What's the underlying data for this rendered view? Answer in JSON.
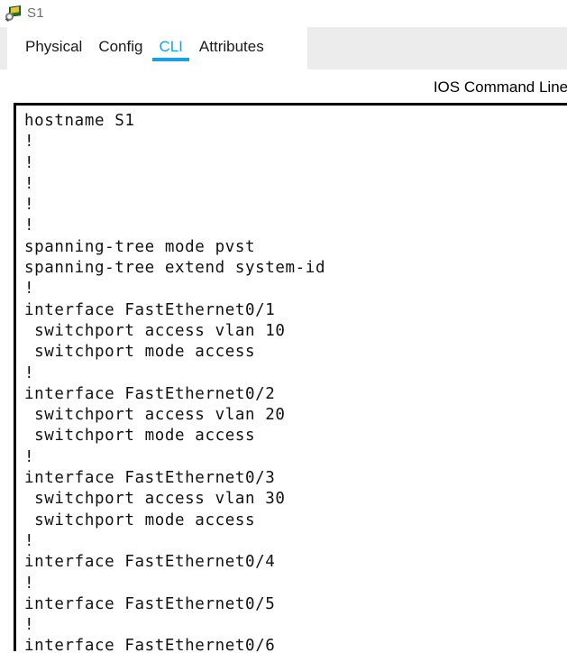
{
  "window": {
    "title": "S1",
    "icon": "switch-magnifier-icon"
  },
  "tabs": [
    {
      "label": "Physical",
      "active": false
    },
    {
      "label": "Config",
      "active": false
    },
    {
      "label": "CLI",
      "active": true
    },
    {
      "label": "Attributes",
      "active": false
    }
  ],
  "cli": {
    "header_title": "IOS Command Line Interface",
    "content": "hostname S1\n!\n!\n!\n!\n!\nspanning-tree mode pvst\nspanning-tree extend system-id\n!\ninterface FastEthernet0/1\n switchport access vlan 10\n switchport mode access\n!\ninterface FastEthernet0/2\n switchport access vlan 20\n switchport mode access\n!\ninterface FastEthernet0/3\n switchport access vlan 30\n switchport mode access\n!\ninterface FastEthernet0/4\n!\ninterface FastEthernet0/5\n!\ninterface FastEthernet0/6"
  },
  "colors": {
    "accent": "#17a2e8",
    "band": "#ececec",
    "title_text": "#6e6e6e",
    "terminal_text": "#111111"
  }
}
